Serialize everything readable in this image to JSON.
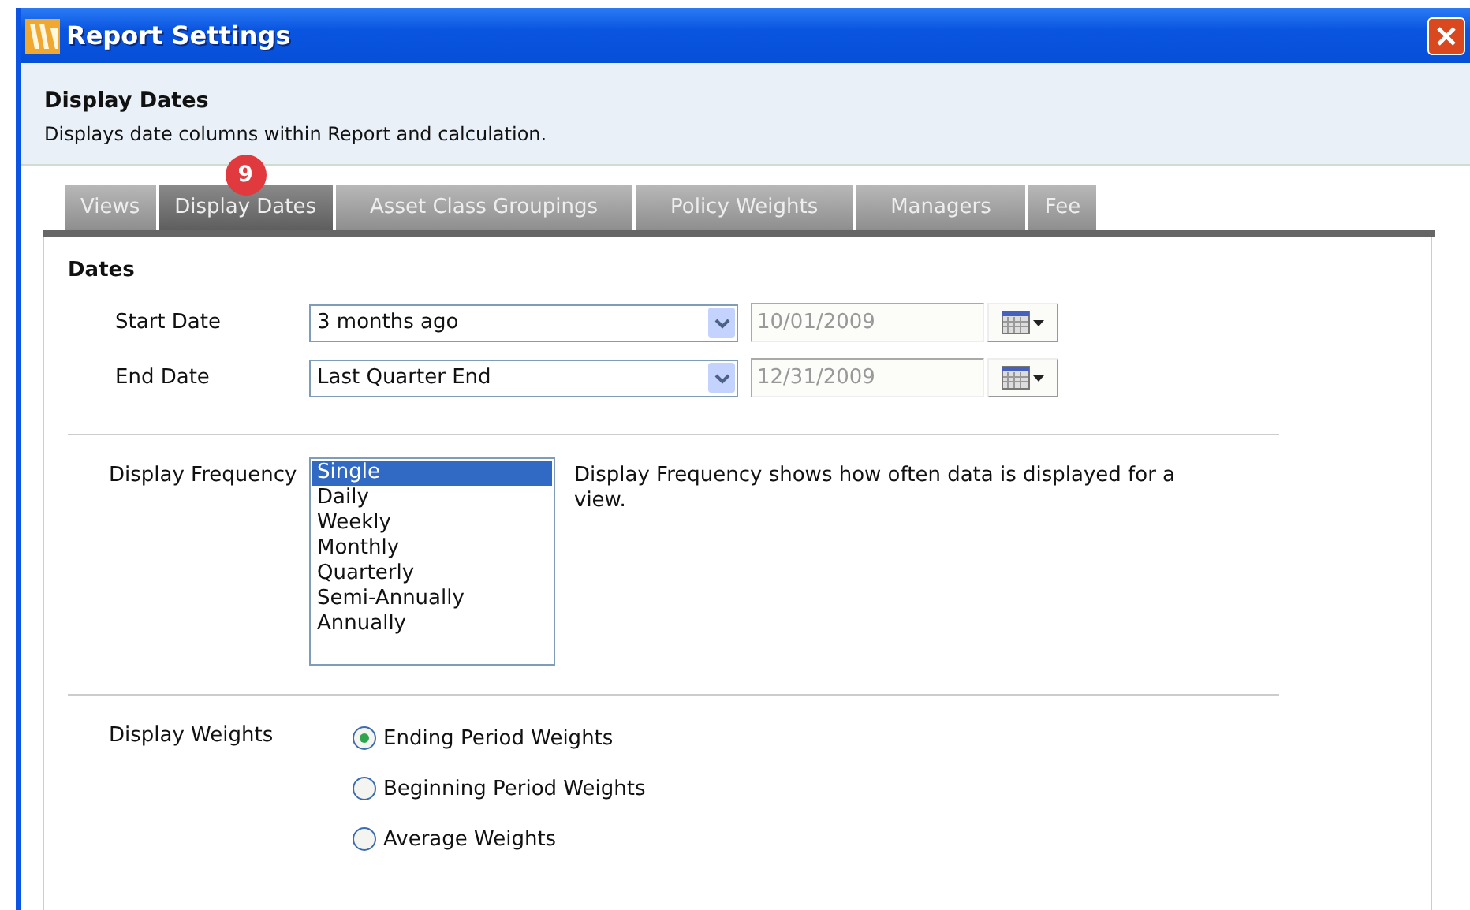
{
  "window": {
    "title": "Report Settings"
  },
  "header": {
    "title": "Display Dates",
    "description": "Displays date columns within Report and calculation."
  },
  "tabs": [
    {
      "label": "Views",
      "selected": false
    },
    {
      "label": "Display Dates",
      "selected": true,
      "badge": "9"
    },
    {
      "label": "Asset Class Groupings",
      "selected": false
    },
    {
      "label": "Policy Weights",
      "selected": false
    },
    {
      "label": "Managers",
      "selected": false
    },
    {
      "label": "Fee",
      "selected": false
    }
  ],
  "dates": {
    "heading": "Dates",
    "rows": [
      {
        "label": "Start Date",
        "value": "3 months ago",
        "date": "10/01/2009"
      },
      {
        "label": "End Date",
        "value": "Last Quarter End",
        "date": "12/31/2009"
      }
    ]
  },
  "frequency": {
    "label": "Display Frequency",
    "description": "Display Frequency shows how often data is displayed for a view.",
    "options": [
      {
        "label": "Single",
        "selected": true
      },
      {
        "label": "Daily",
        "selected": false
      },
      {
        "label": "Weekly",
        "selected": false
      },
      {
        "label": "Monthly",
        "selected": false
      },
      {
        "label": "Quarterly",
        "selected": false
      },
      {
        "label": "Semi-Annually",
        "selected": false
      },
      {
        "label": "Annually",
        "selected": false
      }
    ]
  },
  "weights": {
    "label": "Display Weights",
    "options": [
      {
        "label": "Ending Period Weights",
        "selected": true
      },
      {
        "label": "Beginning Period Weights",
        "selected": false
      },
      {
        "label": "Average Weights",
        "selected": false
      }
    ]
  }
}
